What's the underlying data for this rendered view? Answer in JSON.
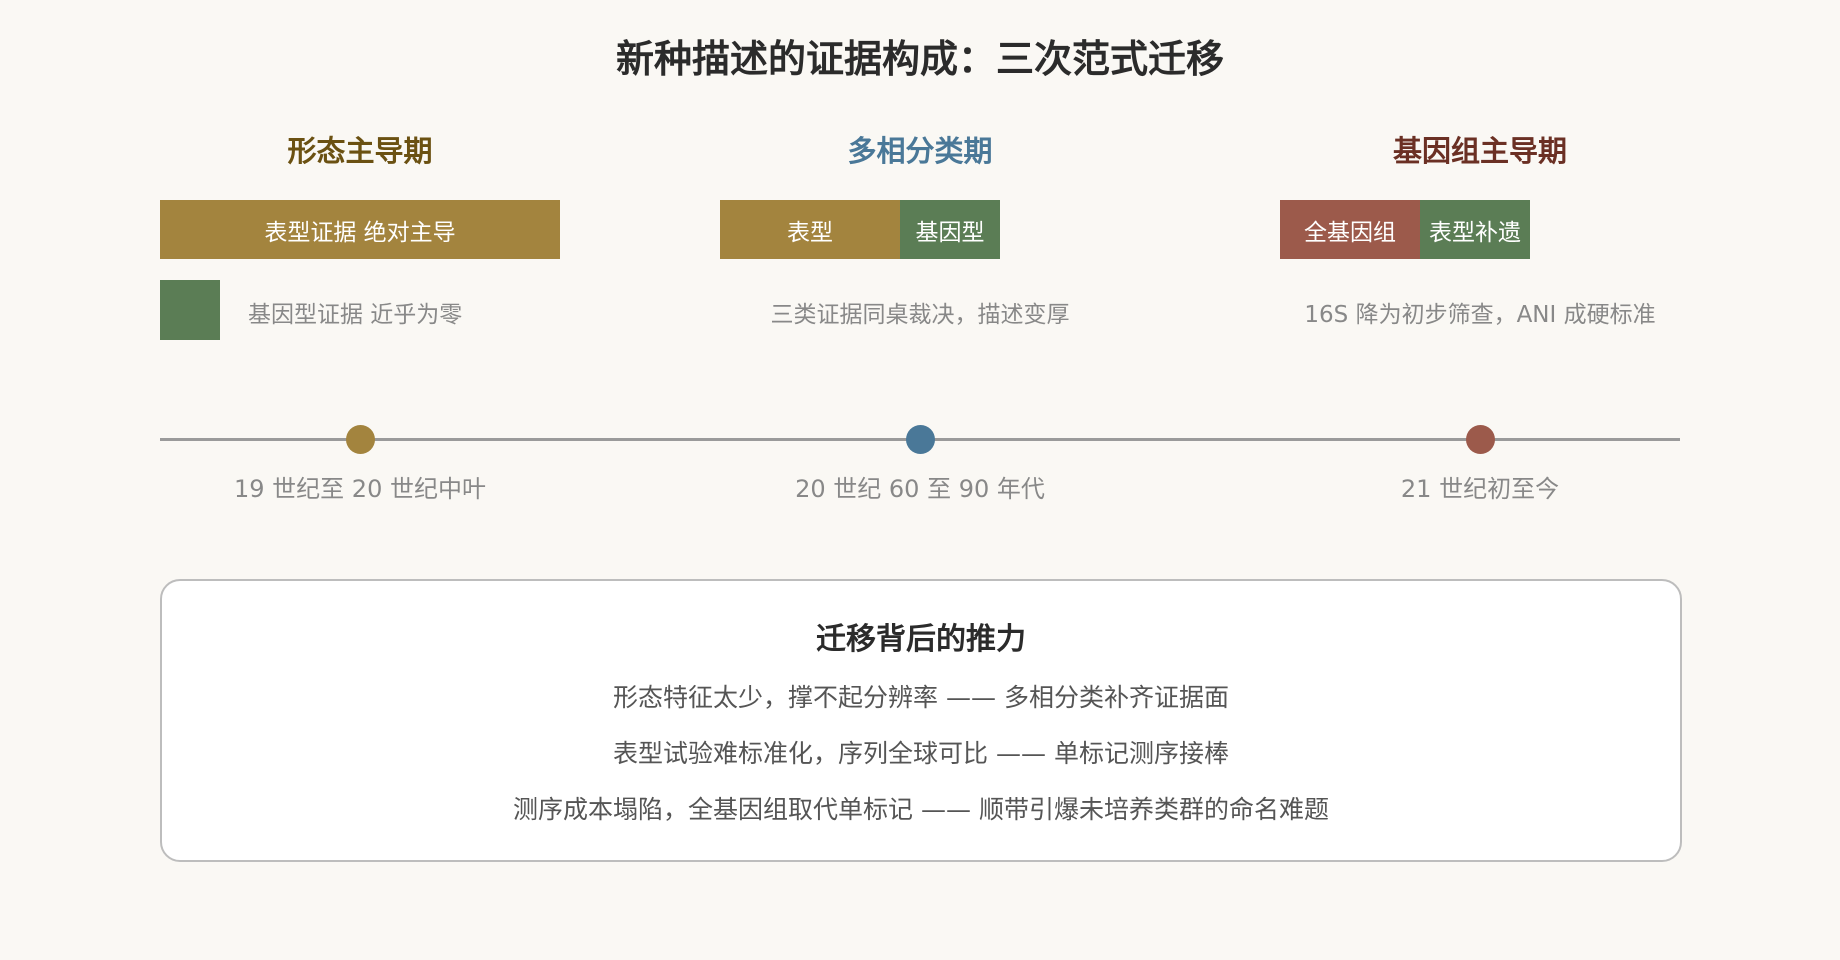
{
  "title": "新种描述的证据构成：三次范式迁移",
  "colors": {
    "phenotype": "#a3843e",
    "genotype": "#5b7d55",
    "genome": "#9c5a4b",
    "phase1_title": "#6b5112",
    "phase2_title": "#4a7898",
    "phase3_title": "#6b3024",
    "dot1": "#a3843e",
    "dot2": "#4a7898",
    "dot3": "#9c5a4b"
  },
  "phases": [
    {
      "title": "形态主导期",
      "bars": [
        {
          "label": "表型证据 绝对主导",
          "kind": "phenotype",
          "share": 0.87
        }
      ],
      "minor_box": {
        "label": "基因型证据 近乎为零",
        "kind": "genotype",
        "share": 0.13
      },
      "description": "",
      "era": "19 世纪至 20 世纪中叶"
    },
    {
      "title": "多相分类期",
      "bars": [
        {
          "label": "表型",
          "kind": "phenotype",
          "share": 0.39
        },
        {
          "label": "基因型",
          "kind": "genotype",
          "share": 0.22
        }
      ],
      "description": "三类证据同桌裁决，描述变厚",
      "era": "20 世纪 60 至 90 年代"
    },
    {
      "title": "基因组主导期",
      "bars": [
        {
          "label": "全基因组",
          "kind": "genome",
          "share": 0.305
        },
        {
          "label": "表型补遗",
          "kind": "genotype",
          "share": 0.24
        }
      ],
      "description": "16S 降为初步筛查，ANI 成硬标准",
      "era": "21 世纪初至今"
    }
  ],
  "drivers": {
    "title": "迁移背后的推力",
    "lines": [
      "形态特征太少，撑不起分辨率 —— 多相分类补齐证据面",
      "表型试验难标准化，序列全球可比 —— 单标记测序接棒",
      "测序成本塌陷，全基因组取代单标记 —— 顺带引爆未培养类群的命名难题"
    ]
  }
}
